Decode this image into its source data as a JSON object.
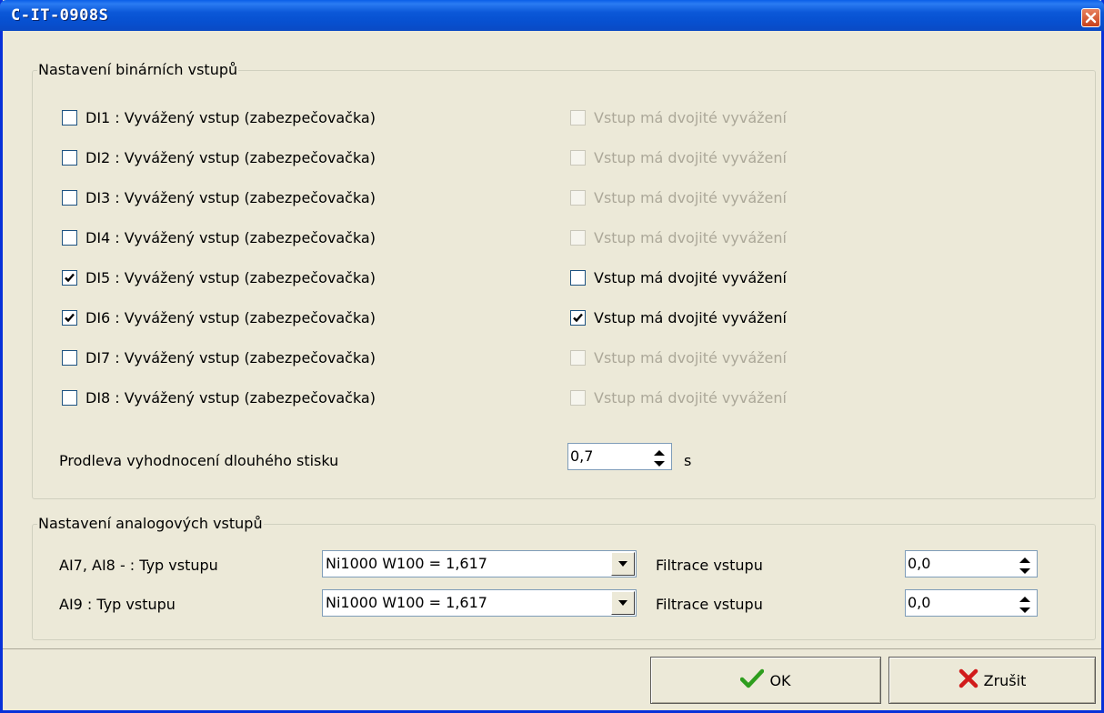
{
  "window": {
    "title": "C-IT-0908S"
  },
  "binary_group": {
    "title": "Nastavení binárních vstupů",
    "inputs": [
      {
        "label": "DI1 : Vyvážený vstup (zabezpečovačka)",
        "checked": false,
        "double_label": "Vstup má dvojité vyvážení",
        "double_checked": false,
        "double_enabled": false
      },
      {
        "label": "DI2 : Vyvážený vstup (zabezpečovačka)",
        "checked": false,
        "double_label": "Vstup má dvojité vyvážení",
        "double_checked": false,
        "double_enabled": false
      },
      {
        "label": "DI3 : Vyvážený vstup (zabezpečovačka)",
        "checked": false,
        "double_label": "Vstup má dvojité vyvážení",
        "double_checked": false,
        "double_enabled": false
      },
      {
        "label": "DI4 : Vyvážený vstup (zabezpečovačka)",
        "checked": false,
        "double_label": "Vstup má dvojité vyvážení",
        "double_checked": false,
        "double_enabled": false
      },
      {
        "label": "DI5 : Vyvážený vstup (zabezpečovačka)",
        "checked": true,
        "double_label": "Vstup má dvojité vyvážení",
        "double_checked": false,
        "double_enabled": true
      },
      {
        "label": "DI6 : Vyvážený vstup (zabezpečovačka)",
        "checked": true,
        "double_label": "Vstup má dvojité vyvážení",
        "double_checked": true,
        "double_enabled": true
      },
      {
        "label": "DI7 : Vyvážený vstup (zabezpečovačka)",
        "checked": false,
        "double_label": "Vstup má dvojité vyvážení",
        "double_checked": false,
        "double_enabled": false
      },
      {
        "label": "DI8 : Vyvážený vstup (zabezpečovačka)",
        "checked": false,
        "double_label": "Vstup má dvojité vyvážení",
        "double_checked": false,
        "double_enabled": false
      }
    ],
    "delay_label": "Prodleva vyhodnocení dlouhého stisku",
    "delay_value": "0,7",
    "delay_unit": "s"
  },
  "analog_group": {
    "title": "Nastavení analogových vstupů",
    "rows": [
      {
        "label": "AI7, AI8 -  : Typ vstupu",
        "type_value": "Ni1000 W100 = 1,617",
        "filter_label": "Filtrace vstupu",
        "filter_value": "0,0"
      },
      {
        "label": "AI9 : Typ vstupu",
        "type_value": "Ni1000 W100 = 1,617",
        "filter_label": "Filtrace vstupu",
        "filter_value": "0,0"
      }
    ]
  },
  "buttons": {
    "ok": "OK",
    "cancel": "Zrušit"
  },
  "colors": {
    "title_bar": "#0a5fe8",
    "face": "#ece9d8",
    "ok_icon": "#2e9e1e",
    "cancel_icon": "#d11b1b",
    "disabled_text": "#aca899"
  },
  "icons": {
    "ok": "checkmark-icon",
    "cancel": "x-icon",
    "close": "close-icon"
  }
}
